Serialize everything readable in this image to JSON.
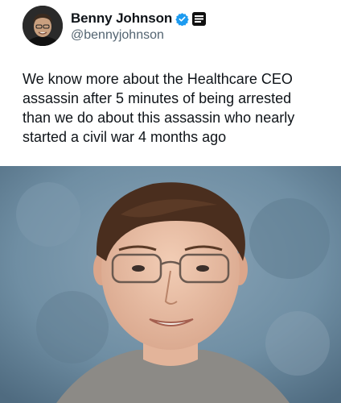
{
  "tweet": {
    "author": {
      "display_name": "Benny Johnson",
      "handle": "@bennyjohnson",
      "verified": true,
      "verified_color": "#1d9bf0"
    },
    "text": "We know more about the Healthcare CEO\nassassin after 5 minutes of being arrested\nthan we do about this assassin who nearly\nstarted a civil war 4 months ago",
    "media": {
      "type": "photo",
      "background_color": "#6f8ea3"
    }
  }
}
